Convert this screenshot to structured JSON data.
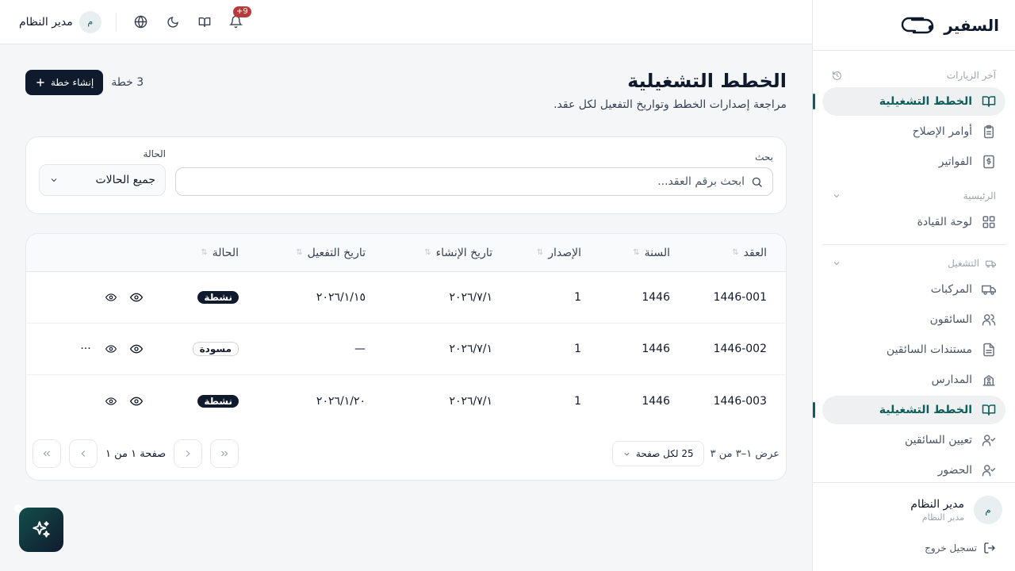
{
  "brand": {
    "name": "السفير"
  },
  "topbar": {
    "notification_count": "+9",
    "user_name": "مدير النظام",
    "user_initial": "م"
  },
  "sidebar": {
    "recent_label": "آخر الزيارات",
    "recent_items": [
      {
        "label": "الخطط التشغيلية",
        "icon": "book-open-icon",
        "active": true
      },
      {
        "label": "أوامر الإصلاح",
        "icon": "clipboard-icon",
        "active": false
      },
      {
        "label": "الفواتير",
        "icon": "invoice-icon",
        "active": false
      }
    ],
    "main_label": "الرئيسية",
    "main_items": [
      {
        "label": "لوحة القيادة",
        "icon": "dashboard-icon",
        "active": false
      }
    ],
    "ops_label": "التشغيل",
    "ops_items": [
      {
        "label": "المركبات",
        "icon": "truck-icon",
        "active": false
      },
      {
        "label": "السائقون",
        "icon": "users-icon",
        "active": false
      },
      {
        "label": "مستندات السائقين",
        "icon": "file-text-icon",
        "active": false
      },
      {
        "label": "المدارس",
        "icon": "school-icon",
        "active": false
      },
      {
        "label": "الخطط التشغيلية",
        "icon": "book-open-icon",
        "active": true
      },
      {
        "label": "تعيين السائقين",
        "icon": "user-check-icon",
        "active": false
      },
      {
        "label": "الحضور",
        "icon": "user-check-icon",
        "active": false
      }
    ],
    "user": {
      "name": "مدير النظام",
      "role": "مدير النظام",
      "initial": "م"
    },
    "logout_label": "تسجيل خروج"
  },
  "page": {
    "title": "الخطط التشغيلية",
    "subtitle": "مراجعة إصدارات الخطط وتواريخ التفعيل لكل عقد.",
    "count_label": "3 خطة",
    "create_label": "إنشاء خطة"
  },
  "filters": {
    "search_label": "بحث",
    "search_placeholder": "ابحث برقم العقد...",
    "status_label": "الحالة",
    "status_value": "جميع الحالات"
  },
  "table": {
    "columns": [
      "العقد",
      "السنة",
      "الإصدار",
      "تاريخ الإنشاء",
      "تاريخ التفعيل",
      "الحالة"
    ],
    "rows": [
      {
        "contract": "1446-001",
        "year": "1446",
        "version": "1",
        "created": "٢٠٢٦/٧/١",
        "activated": "٢٠٢٦/١/١٥",
        "status": "نشطة",
        "status_type": "active",
        "more": ""
      },
      {
        "contract": "1446-002",
        "year": "1446",
        "version": "1",
        "created": "٢٠٢٦/٧/١",
        "activated": "—",
        "status": "مسودة",
        "status_type": "draft",
        "more": "···"
      },
      {
        "contract": "1446-003",
        "year": "1446",
        "version": "1",
        "created": "٢٠٢٦/٧/١",
        "activated": "٢٠٢٦/١/٢٠",
        "status": "نشطة",
        "status_type": "active",
        "more": ""
      }
    ]
  },
  "pagination": {
    "showing": "عرض ١–٣ من ٣",
    "per_page": "25 لكل صفحة",
    "page_info": "صفحة ١ من ١"
  },
  "colors": {
    "accent": "#0f5e5a",
    "primary": "#0f1b2d",
    "badge": "#b83b3b"
  }
}
